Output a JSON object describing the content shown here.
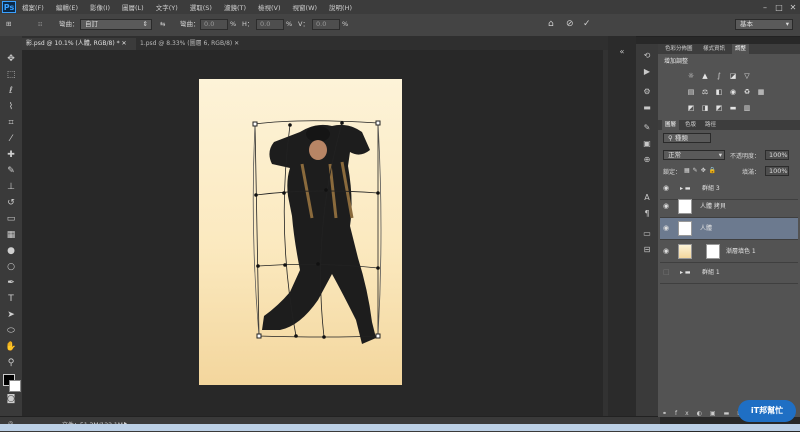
{
  "app": {
    "logo": "Ps"
  },
  "menu": [
    "檔案(F)",
    "編輯(E)",
    "影像(I)",
    "圖層(L)",
    "文字(Y)",
    "選取(S)",
    "濾鏡(T)",
    "檢視(V)",
    "視窗(W)",
    "說明(H)"
  ],
  "options": {
    "warp_label": "彎曲：",
    "warp_value": "自訂",
    "bend_label": "彎曲：",
    "bend_value": "0.0",
    "percent": "%",
    "h_label": "H：",
    "h_value": "0.0",
    "v_label": "V：",
    "v_value": "0.0",
    "workspace": "基本"
  },
  "tabs": [
    {
      "label": "影.psd @ 10.1% (人體, RGB/8) *",
      "active": true
    },
    {
      "label": "1.psd @ 8.33% (圖層 6, RGB/8)",
      "active": false
    }
  ],
  "status": {
    "doc_info": "文件：51.3M/122.1M"
  },
  "adjust": {
    "tabs": [
      "色彩分佈圖",
      "樣式資訊",
      "調整"
    ],
    "title": "增加調整"
  },
  "layers": {
    "tabs": [
      "圖層",
      "色版",
      "路徑"
    ],
    "filter_kind": "種類",
    "blend_mode": "正常",
    "opacity_label": "不透明度：",
    "opacity_value": "100%",
    "lock_label": "鎖定：",
    "fill_label": "填滿：",
    "fill_value": "100%",
    "items": [
      {
        "name": "群組 3",
        "type": "group",
        "visible": true,
        "selected": false
      },
      {
        "name": "人體 拷貝",
        "type": "layer",
        "visible": true,
        "selected": false
      },
      {
        "name": "人體",
        "type": "layer",
        "visible": true,
        "selected": true
      },
      {
        "name": "漸層填色 1",
        "type": "fill",
        "visible": true,
        "selected": false
      },
      {
        "name": "群組 1",
        "type": "group",
        "visible": false,
        "selected": false
      }
    ]
  },
  "watermark": {
    "text": "iT邦幫忙"
  },
  "colors": {
    "accent": "#3aa0ff",
    "selected_layer": "#6c7a8f",
    "doc_top": "#fdf3d8",
    "doc_bottom": "#f3d69d"
  }
}
